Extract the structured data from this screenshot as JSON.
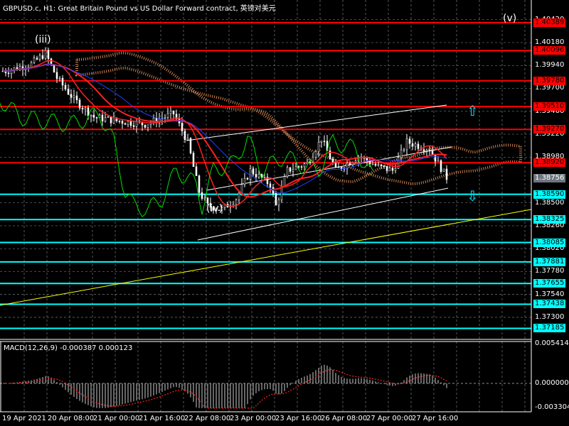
{
  "header": {
    "title": "GBPUSD.c, H1:  Great Britain Pound vs US Dollar Forward contract, 英镑对美元"
  },
  "wave_labels": {
    "iii": "(iii)",
    "iv": "(iv)",
    "v": "(v)"
  },
  "colors": {
    "resistance": "#ff0000",
    "support": "#00ffff",
    "current": "#6e7780",
    "trend": "#ffff00",
    "channel": "#ffffff",
    "cloud": "#ffa060",
    "ma_red": "#ff2020",
    "ma_blue": "#2040ff",
    "chikou": "#00e000"
  },
  "chart_data": {
    "type": "candlestick",
    "symbol": "GBPUSD.c",
    "timeframe": "H1",
    "ylim": [
      1.371,
      1.4048
    ],
    "y_ticks": [
      "1.40420",
      "1.40180",
      "1.39940",
      "1.39700",
      "1.39460",
      "1.39220",
      "1.38980",
      "1.38500",
      "1.38260",
      "1.38020",
      "1.37780",
      "1.37540",
      "1.37300"
    ],
    "resistance_levels": [
      "1.40389",
      "1.40096",
      "1.39780",
      "1.39510",
      "1.39270",
      "1.38920"
    ],
    "support_levels": [
      "1.38590",
      "1.38325",
      "1.38085",
      "1.37881",
      "1.37655",
      "1.37438",
      "1.37185"
    ],
    "current_price": "1.38756",
    "x_ticks": [
      "19 Apr 2021",
      "20 Apr 08:00",
      "21 Apr 00:00",
      "21 Apr 16:00",
      "22 Apr 08:00",
      "23 Apr 00:00",
      "23 Apr 16:00",
      "26 Apr 08:00",
      "27 Apr 00:00",
      "27 Apr 16:00"
    ],
    "price_path": {
      "bar": [
        1,
        10,
        15,
        19,
        25,
        32,
        40,
        50,
        60,
        65,
        69,
        72,
        77,
        82,
        87,
        94,
        96,
        100,
        107,
        112,
        117,
        125,
        132,
        137,
        142,
        150,
        156
      ],
      "close": [
        1.39882,
        1.39957,
        1.40068,
        1.39808,
        1.39585,
        1.39399,
        1.39361,
        1.39324,
        1.39436,
        1.39138,
        1.38617,
        1.38468,
        1.38431,
        1.38543,
        1.3884,
        1.38692,
        1.38468,
        1.3884,
        1.38915,
        1.39175,
        1.3884,
        1.38989,
        1.38878,
        1.3884,
        1.39138,
        1.39064,
        1.38766
      ]
    },
    "macd": {
      "label": "MACD(12,26,9) -0.000387 0.000123",
      "ylim": [
        -0.003304,
        0.005414
      ],
      "y_ticks": [
        "0.005414",
        "0.000000",
        "-0.003304"
      ]
    }
  }
}
